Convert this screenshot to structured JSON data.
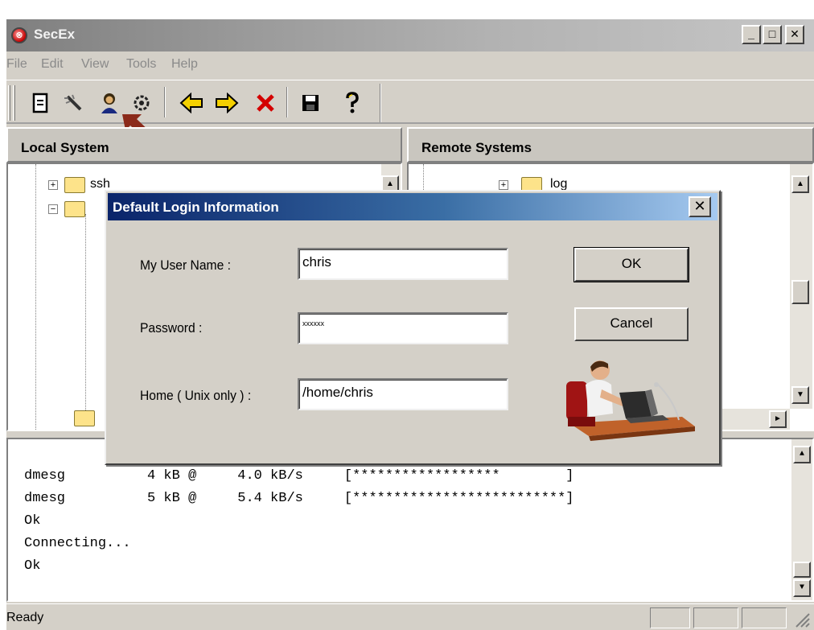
{
  "window": {
    "title": "SecEx",
    "controls": {
      "minimize": "_",
      "maximize": "□",
      "close": "✕"
    }
  },
  "menu": [
    "File",
    "Edit",
    "View",
    "Tools",
    "Help"
  ],
  "toolbar": {
    "icons": [
      "properties-icon",
      "wizard-wand-icon",
      "user-login-icon",
      "settings-gear-icon",
      "back-arrow-icon",
      "forward-arrow-icon",
      "stop-x-icon",
      "save-disk-icon",
      "help-question-icon"
    ]
  },
  "panes": {
    "local": {
      "header": "Local System",
      "tree": [
        {
          "label": "ssh",
          "expander": "+"
        },
        {
          "label": "",
          "expander": "−"
        }
      ]
    },
    "remote": {
      "header": "Remote Systems",
      "tree": [
        {
          "label": "log",
          "expander": "+"
        }
      ]
    }
  },
  "log": {
    "lines": [
      "dmesg          4 kB @     4.0 kB/s     [******************        ]",
      "dmesg          5 kB @     5.4 kB/s     [**************************]",
      "Ok",
      "Connecting...",
      "Ok"
    ]
  },
  "status": {
    "text": "Ready"
  },
  "dialog": {
    "title": "Default Login Information",
    "close": "✕",
    "fields": {
      "username": {
        "label": "My User Name :",
        "value": "chris"
      },
      "password": {
        "label": "Password :",
        "value": "xxxxxx"
      },
      "home": {
        "label": "Home ( Unix only ) :",
        "value": "/home/chris"
      }
    },
    "buttons": {
      "ok": "OK",
      "cancel": "Cancel"
    }
  },
  "colors": {
    "dialog_title_start": "#0a246a",
    "dialog_title_end": "#a6caf0",
    "window_face": "#d4d0c8",
    "stop_icon": "#d40000",
    "arrow_icon": "#f4d000"
  }
}
